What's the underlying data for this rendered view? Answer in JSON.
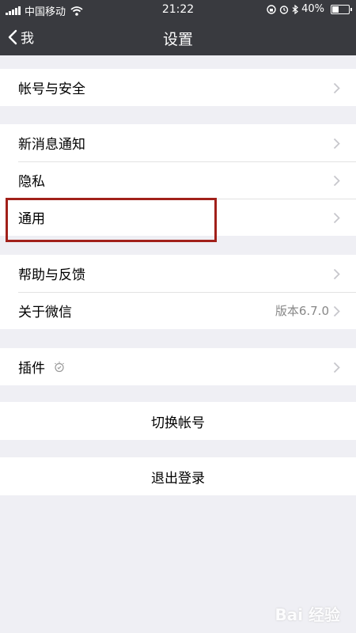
{
  "status_bar": {
    "carrier": "中国移动",
    "time": "21:22",
    "battery": "40%",
    "battery_level": 0.4
  },
  "nav": {
    "back_label": "我",
    "title": "设置"
  },
  "groups": [
    {
      "items": [
        {
          "label": "帐号与安全"
        }
      ]
    },
    {
      "items": [
        {
          "label": "新消息通知"
        },
        {
          "label": "隐私"
        },
        {
          "label": "通用"
        }
      ]
    },
    {
      "items": [
        {
          "label": "帮助与反馈"
        },
        {
          "label": "关于微信",
          "value": "版本6.7.0"
        }
      ]
    },
    {
      "items": [
        {
          "label": "插件",
          "icon": "plugin-bulb-icon"
        }
      ]
    }
  ],
  "actions": {
    "switch_account": "切换帐号",
    "logout": "退出登录"
  },
  "highlighted_item": "通用",
  "watermark": "Bai 经验",
  "colors": {
    "nav_background": "#393a3f",
    "page_background": "#efeff4",
    "highlight_border": "#a1201a"
  }
}
